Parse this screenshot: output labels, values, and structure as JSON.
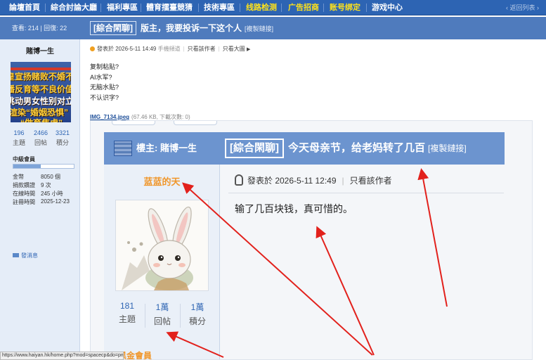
{
  "nav": {
    "items": [
      "論壇首頁",
      "綜合討論大廳",
      "福利專區",
      "體育擂臺競猜",
      "技術專區",
      "线路检测",
      "广告招商",
      "账号绑定",
      "游戏中心"
    ],
    "back_label": "‹ 返回列表 ›"
  },
  "thread": {
    "views_replies": "查看: 214 | 回復: 22",
    "category": "[綜合閑聊]",
    "title": "版主，我要投诉一下这个人",
    "copy_link": "[複製鏈接]"
  },
  "author": {
    "name": "賭博一生",
    "avatar_lines": [
      "皇宣扬赌败不婚不",
      "播反育等不良价值",
      "挑动男女性别对立",
      "渲染“婚姻恐惧”",
      "“做育焦虑”"
    ],
    "stats": [
      {
        "value": "196",
        "label": "主題"
      },
      {
        "value": "2466",
        "label": "回帖"
      },
      {
        "value": "3321",
        "label": "積分"
      }
    ],
    "rank": "中級會員",
    "rank_progress": 0.45,
    "info": [
      {
        "key": "金幣",
        "value": "8050 個"
      },
      {
        "key": "捐款鑽證",
        "value": "9 次"
      },
      {
        "key": "在線時間",
        "value": "245 小時"
      },
      {
        "key": "註冊時間",
        "value": "2025-12-23"
      }
    ],
    "send_message": "發消息"
  },
  "post": {
    "meta_posted": "發表於 2026-5-11 14:49",
    "meta_mobile": "手機頻道",
    "meta_author_only": "只看該作者",
    "meta_big_image": "只看大圖",
    "lines": [
      "复制粘贴?",
      "AI水军?",
      "无脑水贴?",
      "不认识字?"
    ],
    "attachment_name": "IMG_7134.jpeg",
    "attachment_info": "(67.46 KB, 下載次數: 0)"
  },
  "embedded": {
    "louzhu": "樓主: 賭博一生",
    "category": "[綜合閑聊]",
    "title": "今天母亲节，给老妈转了几百",
    "copy_link": "[複製鏈接]",
    "user": "蓝蓝的天",
    "stats": [
      {
        "value": "181",
        "label": "主題"
      },
      {
        "value": "1萬",
        "label": "回帖"
      },
      {
        "value": "1萬",
        "label": "積分"
      }
    ],
    "rank": "黑金會員",
    "meta_posted": "發表於 2026-5-11 12:49",
    "meta_author_only": "只看該作者",
    "body": "输了几百块钱，真可惜的。"
  },
  "statusbar_url": "https://www.haiyan.hk/home.php?mod=spacecp&do=pm",
  "colors": {
    "nav_bg": "#2d64b3",
    "accent_orange": "#f0962a",
    "annotation_red": "#e2211c"
  }
}
